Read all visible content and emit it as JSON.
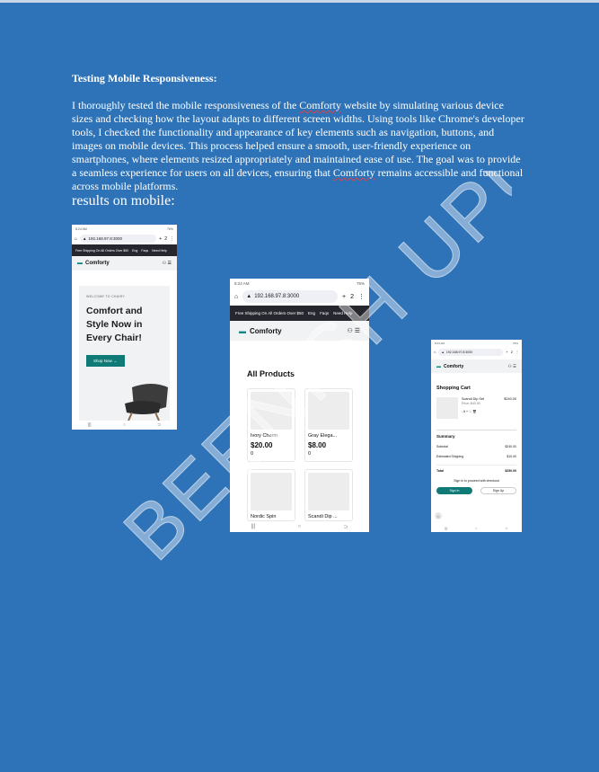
{
  "document": {
    "heading": "Testing Mobile Responsiveness:",
    "paragraph_before": "I thoroughly tested the mobile responsiveness of the ",
    "brand_word": "Comforty",
    "paragraph_after": " website by simulating various device sizes and checking how the layout adapts to different screen widths. Using tools like Chrome's developer tools, I checked the functionality and appearance of key elements such as navigation, buttons, and images on mobile devices. This process helped ensure a smooth, user-friendly experience on smartphones, where elements resized appropriately and maintained ease of use. The goal was to provide a seamless experience for users on all devices, ensuring that ",
    "brand_word_2": "Comforty",
    "paragraph_end": " remains accessible and functional across mobile platforms.",
    "results_label": "results on mobile:",
    "watermark": "BEENISH UPUT"
  },
  "browser": {
    "time": "8:24 AM",
    "battery": "76%",
    "url": "192.168.97.8:3000",
    "tab_count": "2"
  },
  "promo": {
    "text": "Free Shipping On All Orders Over $50",
    "language": "Eng",
    "faqs": "Faqs",
    "help": "Need Help"
  },
  "brand": {
    "name": "Comforty"
  },
  "phone1": {
    "welcome": "WELCOME TO CHAIRY",
    "hero_title": "Comfort and Style Now in Every Chair!",
    "button": "Shop Now →"
  },
  "phone2": {
    "section_title": "All Products",
    "products": [
      {
        "name": "Ivory Charm",
        "price": "$20.00",
        "qty": "0"
      },
      {
        "name": "Gray Elega...",
        "price": "$8.00",
        "qty": "0"
      },
      {
        "name": "Nordic Spin",
        "price": "",
        "qty": ""
      },
      {
        "name": "Scandi Dip ...",
        "price": "",
        "qty": ""
      }
    ]
  },
  "phone3": {
    "title": "Shopping Cart",
    "item_name": "Scandi Dip Set",
    "item_total": "$240.00",
    "item_price": "Price: $40.00",
    "item_qty": "- 6 + ♡ 🗑",
    "summary_title": "Summary",
    "subtotal_label": "Subtotal",
    "subtotal_value": "$240.00",
    "shipping_label": "Estimated Shipping",
    "shipping_value": "$10.00",
    "total_label": "Total",
    "total_value": "$250.00",
    "signin_note": "Sign in to proceed with checkout",
    "signin_btn": "Sign In",
    "signup_btn": "Sign Up"
  },
  "colors": {
    "page_background": "#2e73b8",
    "accent_teal": "#0f7a76",
    "promo_bar": "#26272e"
  }
}
